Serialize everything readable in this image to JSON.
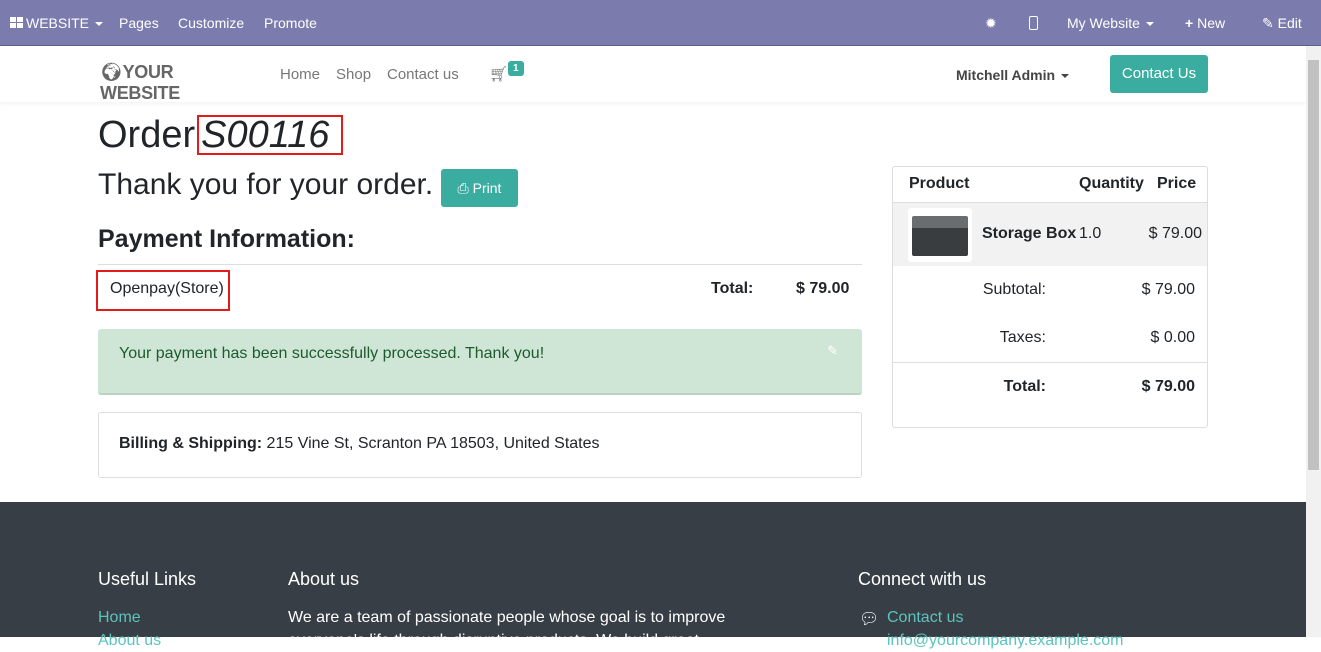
{
  "topbar": {
    "website": "WEBSITE",
    "pages": "Pages",
    "customize": "Customize",
    "promote": "Promote",
    "site_select": "My Website",
    "new": "New",
    "edit": "Edit"
  },
  "nav": {
    "logo": "YOUR WEBSITE",
    "links": [
      "Home",
      "Shop",
      "Contact us"
    ],
    "cart_count": "1",
    "user": "Mitchell Admin",
    "contact_button": "Contact Us"
  },
  "order": {
    "label": "Order",
    "number": "S00116",
    "thanks": "Thank you for your order.",
    "print": "Print",
    "payment_heading": "Payment Information:",
    "payment_method": "Openpay(Store)",
    "total_label": "Total:",
    "total_value": "$ 79.00",
    "success": "Your payment has been successfully processed. Thank you!",
    "billing_label": "Billing & Shipping:",
    "billing_address": "215 Vine St, Scranton PA 18503, United States"
  },
  "summary": {
    "headers": [
      "Product",
      "Quantity",
      "Price"
    ],
    "product": "Storage Box",
    "quantity": "1.0",
    "price": "$ 79.00",
    "subtotal_label": "Subtotal:",
    "subtotal": "$ 79.00",
    "taxes_label": "Taxes:",
    "taxes": "$ 0.00",
    "total_label": "Total:",
    "total": "$ 79.00"
  },
  "footer": {
    "useful_links": "Useful Links",
    "about_heading": "About us",
    "connect": "Connect with us",
    "links": [
      "Home",
      "About us"
    ],
    "about_text": [
      "We are a team of passionate people whose goal is to improve",
      "everyone's life through disruptive products. We build great"
    ],
    "contact": "Contact us",
    "email": "info@yourcompany.example.com"
  },
  "colors": {
    "topbar": "#7c7bad",
    "accent": "#3aada0",
    "footer": "#383e45",
    "success_bg": "#cfe6d6"
  }
}
